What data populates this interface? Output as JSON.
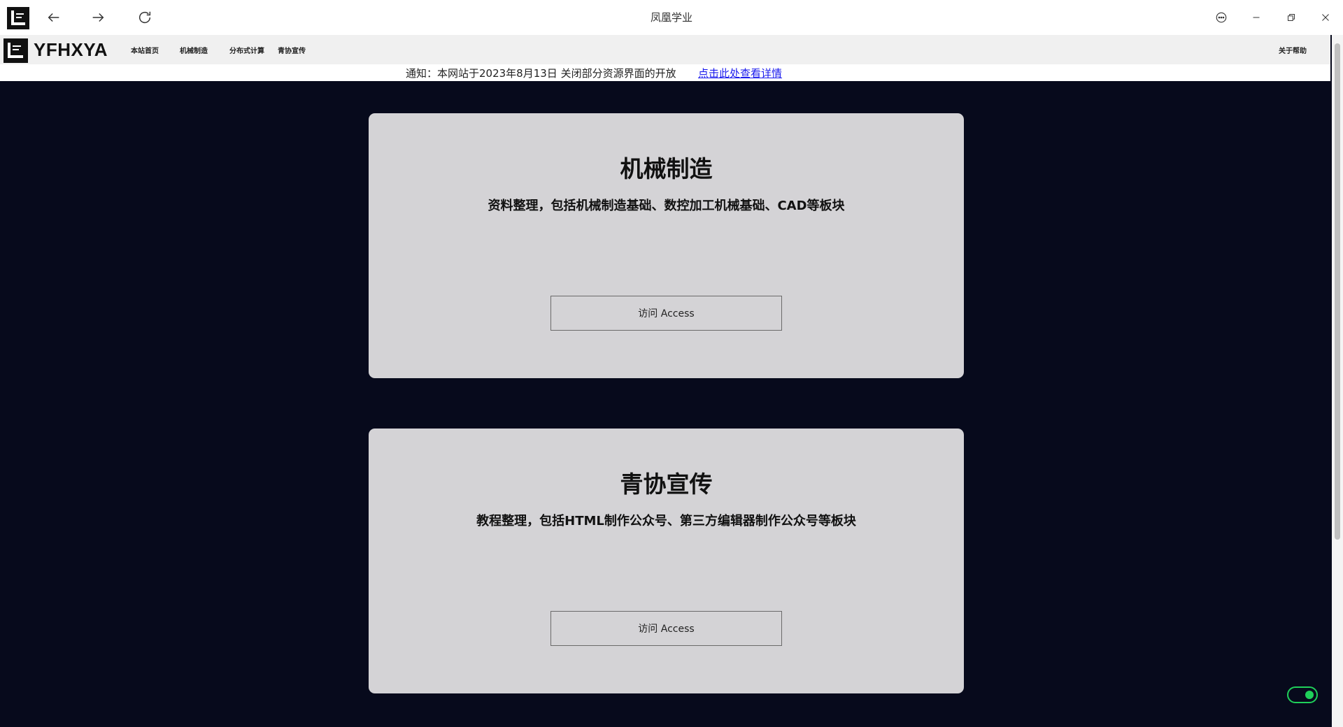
{
  "window": {
    "title": "凤凰学业",
    "controls": [
      "back-icon",
      "forward-icon",
      "refresh-icon",
      "more-icon",
      "minimize-icon",
      "restore-icon",
      "close-icon"
    ]
  },
  "header": {
    "brand": "YFHXYA",
    "nav": [
      "本站首页",
      "机械制造",
      "分布式计算",
      "青协宣传"
    ],
    "help": "关于帮助"
  },
  "notice": {
    "text": "通知：本网站于2023年8月13日 关闭部分资源界面的开放",
    "link": "点击此处查看详情"
  },
  "cards": [
    {
      "title": "机械制造",
      "description": "资料整理，包括机械制造基础、数控加工机械基础、CAD等板块",
      "button": "访问 Access"
    },
    {
      "title": "青协宣传",
      "description": "教程整理，包括HTML制作公众号、第三方编辑器制作公众号等板块",
      "button": "访问 Access"
    }
  ],
  "toggle": {
    "state": "on",
    "color": "#1fd05a"
  },
  "colors": {
    "background": "#070a1c",
    "card": "#d4d3d6",
    "link": "#1a1aee"
  }
}
